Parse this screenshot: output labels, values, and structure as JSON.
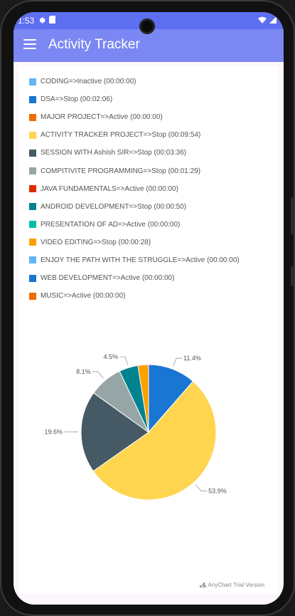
{
  "status": {
    "time": "1:53"
  },
  "app": {
    "title": "Activity Tracker"
  },
  "legend": [
    {
      "label": "CODING=>Inactive (00:00:00)",
      "color": "#64b5f6"
    },
    {
      "label": "DSA=>Stop (00:02:06)",
      "color": "#1976d2"
    },
    {
      "label": "MAJOR PROJECT=>Active (00:00:00)",
      "color": "#ef6c00"
    },
    {
      "label": "ACTIVITY TRACKER PROJECT=>Stop (00:09:54)",
      "color": "#ffd54f"
    },
    {
      "label": "SESSION WITH Ashish SIR=>Stop (00:03:36)",
      "color": "#455a64"
    },
    {
      "label": "COMPITIVITE PROGRAMMING=>Stop (00:01:29)",
      "color": "#96a6a6"
    },
    {
      "label": "JAVA FUNDAMENTALS=>Active (00:00:00)",
      "color": "#dd2c00"
    },
    {
      "label": "ANDROID DEVELOPMENT=>Stop (00:00:50)",
      "color": "#00838f"
    },
    {
      "label": "PRESENTATION OF AD=>Active (00:00:00)",
      "color": "#00bfa5"
    },
    {
      "label": "VIDEO EDITING=>Stop (00:00:28)",
      "color": "#ffa000"
    },
    {
      "label": "ENJOY THE PATH WITH THE STRUGGLE=>Active (00:00:00)",
      "color": "#64b5f6"
    },
    {
      "label": "WEB DEVELOPMENT=>Active (00:00:00)",
      "color": "#1976d2"
    },
    {
      "label": "MUSIC=>Active (00:00:00)",
      "color": "#ef6c00"
    }
  ],
  "chart_data": {
    "type": "pie",
    "title": "",
    "slices": [
      {
        "name": "DSA",
        "value": 126,
        "label": "11.4%",
        "color": "#1976d2"
      },
      {
        "name": "ACTIVITY TRACKER PROJECT",
        "value": 594,
        "label": "53.9%",
        "color": "#ffd54f"
      },
      {
        "name": "SESSION WITH Ashish SIR",
        "value": 216,
        "label": "19.6%",
        "color": "#455a64"
      },
      {
        "name": "COMPITIVITE PROGRAMMING",
        "value": 89,
        "label": "8.1%",
        "color": "#96a6a6"
      },
      {
        "name": "ANDROID DEVELOPMENT",
        "value": 50,
        "label": "4.5%",
        "color": "#00838f"
      },
      {
        "name": "VIDEO EDITING",
        "value": 28,
        "label": "",
        "color": "#ffa000"
      }
    ]
  },
  "watermark": {
    "text": "AnyChart Trial Version"
  }
}
